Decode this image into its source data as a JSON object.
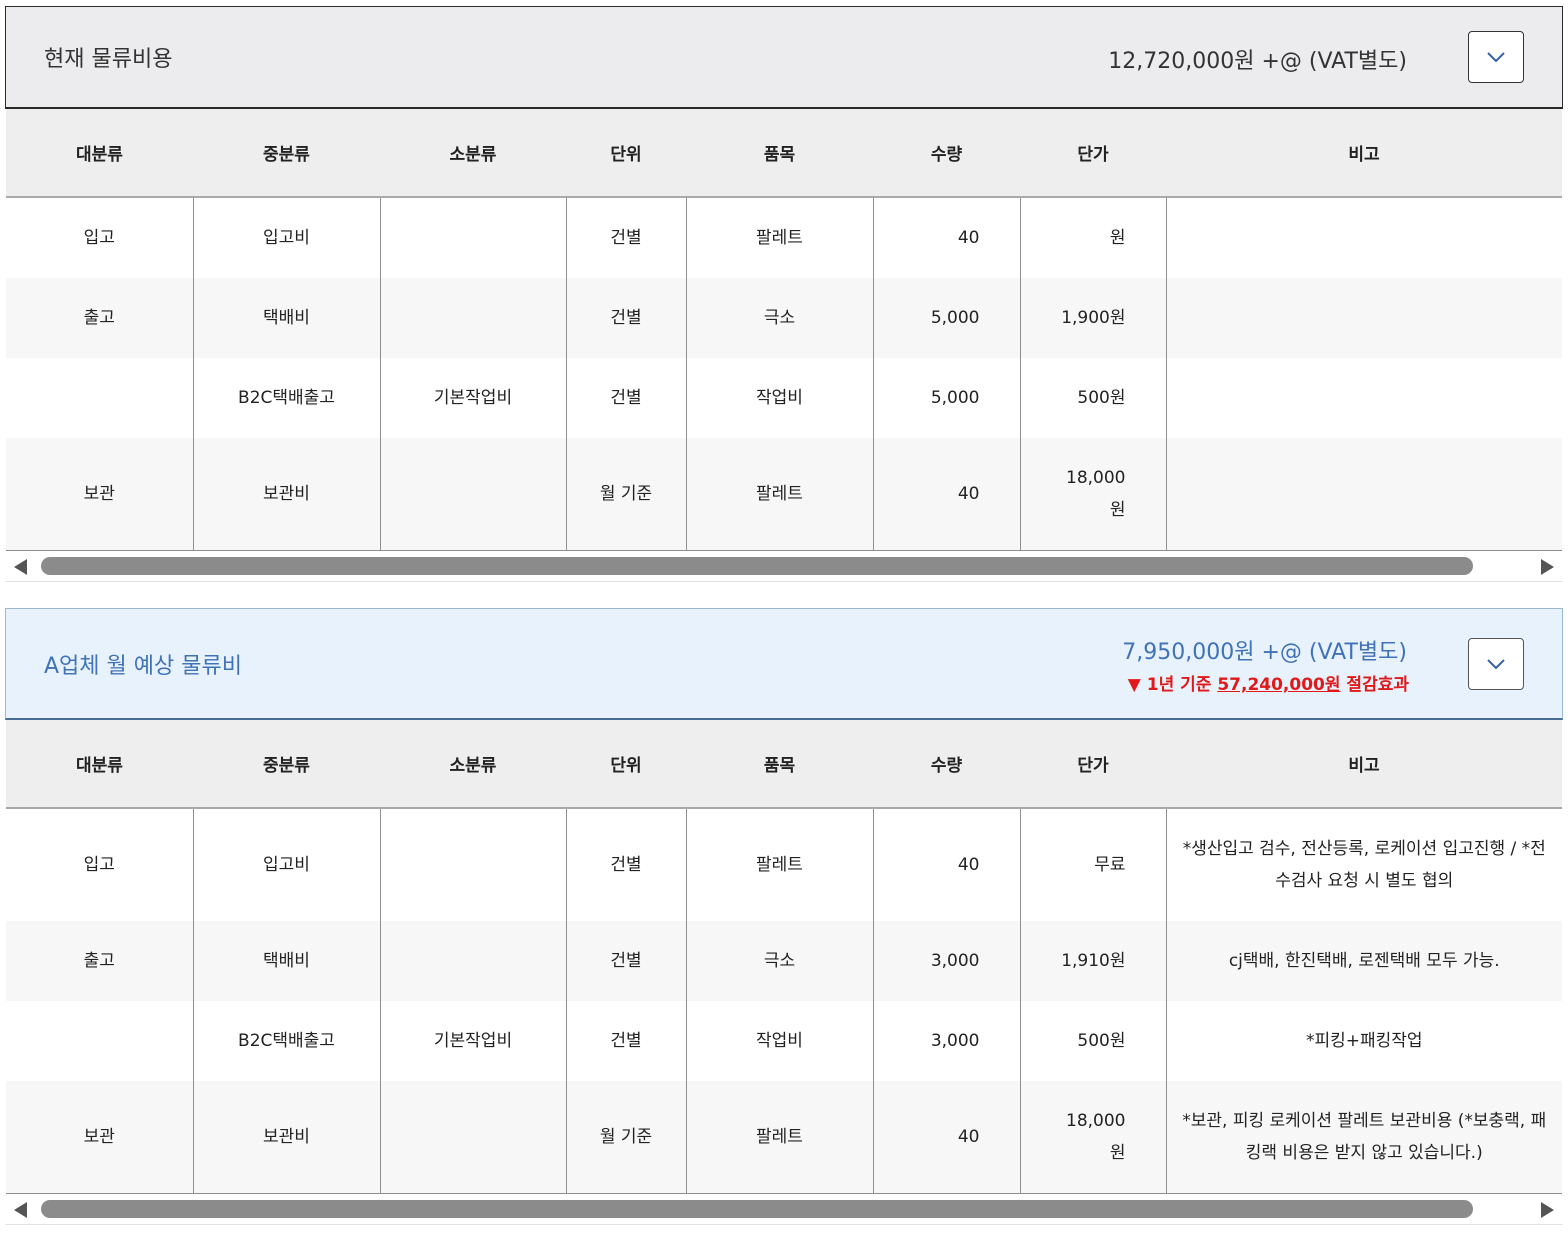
{
  "columns": [
    "대분류",
    "중분류",
    "소분류",
    "단위",
    "품목",
    "수량",
    "단가",
    "비고"
  ],
  "current": {
    "title": "현재 물류비용",
    "amount": "12,720,000원 +@ (VAT별도)",
    "rows": [
      {
        "major": "입고",
        "middle": "입고비",
        "minor": "",
        "unit": "건별",
        "item": "팔레트",
        "qty": "40",
        "price": "원",
        "note": ""
      },
      {
        "major": "출고",
        "middle": "택배비",
        "minor": "",
        "unit": "건별",
        "item": "극소",
        "qty": "5,000",
        "price": "1,900원",
        "note": ""
      },
      {
        "major": "",
        "middle": "B2C택배출고",
        "minor": "기본작업비",
        "unit": "건별",
        "item": "작업비",
        "qty": "5,000",
        "price": "500원",
        "note": ""
      },
      {
        "major": "보관",
        "middle": "보관비",
        "minor": "",
        "unit": "월 기준",
        "item": "팔레트",
        "qty": "40",
        "price": "18,000원",
        "note": ""
      }
    ]
  },
  "proposal": {
    "title": "A업체 월 예상 물류비",
    "amount": "7,950,000원 +@ (VAT별도)",
    "savings_prefix": "▼ 1년 기준 ",
    "savings_amount": "57,240,000원",
    "savings_suffix": " 절감효과",
    "rows": [
      {
        "major": "입고",
        "middle": "입고비",
        "minor": "",
        "unit": "건별",
        "item": "팔레트",
        "qty": "40",
        "price": "무료",
        "note": "*생산입고 검수, 전산등록, 로케이션 입고진행 / *전수검사 요청 시 별도 협의"
      },
      {
        "major": "출고",
        "middle": "택배비",
        "minor": "",
        "unit": "건별",
        "item": "극소",
        "qty": "3,000",
        "price": "1,910원",
        "note": "cj택배, 한진택배, 로젠택배 모두 가능."
      },
      {
        "major": "",
        "middle": "B2C택배출고",
        "minor": "기본작업비",
        "unit": "건별",
        "item": "작업비",
        "qty": "3,000",
        "price": "500원",
        "note": "*피킹+패킹작업"
      },
      {
        "major": "보관",
        "middle": "보관비",
        "minor": "",
        "unit": "월 기준",
        "item": "팔레트",
        "qty": "40",
        "price": "18,000원",
        "note": "*보관, 피킹 로케이션 팔레트 보관비용 (*보충랙, 패킹랙 비용은 받지 않고 있습니다.)"
      }
    ]
  },
  "icons": {
    "toggle": "chevron-down-icon",
    "scroll_left": "scroll-left-arrow-icon",
    "scroll_right": "scroll-right-arrow-icon"
  },
  "colors": {
    "proposal_accent": "#3f72b7",
    "savings": "#e01a1a"
  }
}
